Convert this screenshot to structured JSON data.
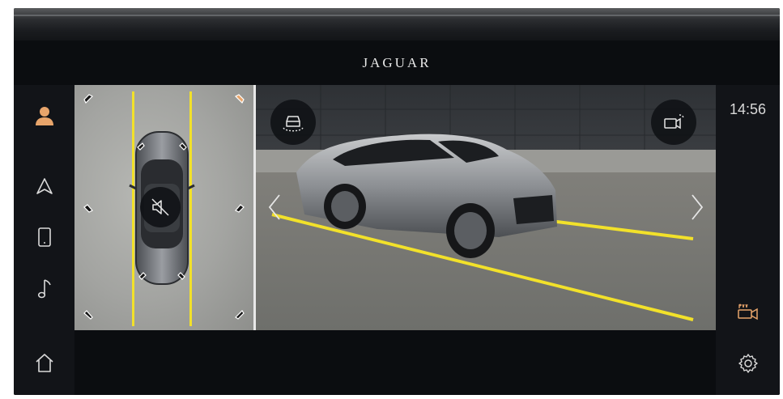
{
  "header": {
    "brand": "JAGUAR"
  },
  "status": {
    "time": "14:56"
  },
  "left_nav": {
    "items": [
      {
        "name": "profile",
        "icon": "person-icon",
        "active": true
      },
      {
        "name": "navigation",
        "icon": "navigation-arrow-icon"
      },
      {
        "name": "phone",
        "icon": "phone-icon"
      },
      {
        "name": "media",
        "icon": "music-note-icon"
      },
      {
        "name": "home",
        "icon": "home-icon"
      }
    ]
  },
  "right_nav": {
    "items": [
      {
        "name": "parking-camera",
        "icon": "park-camera-icon",
        "active": true
      },
      {
        "name": "settings",
        "icon": "gear-icon"
      }
    ]
  },
  "top_view": {
    "mute": {
      "icon": "speaker-muted-icon"
    }
  },
  "camera_view": {
    "buttons": [
      {
        "name": "view-3d",
        "icon": "car-360-icon"
      },
      {
        "name": "camera-select",
        "icon": "camera-switch-icon"
      }
    ]
  },
  "colors": {
    "accent": "#e8a56b",
    "guide_line": "#f2e12a",
    "background": "#0b0d10",
    "icon": "#d9d9d9"
  }
}
